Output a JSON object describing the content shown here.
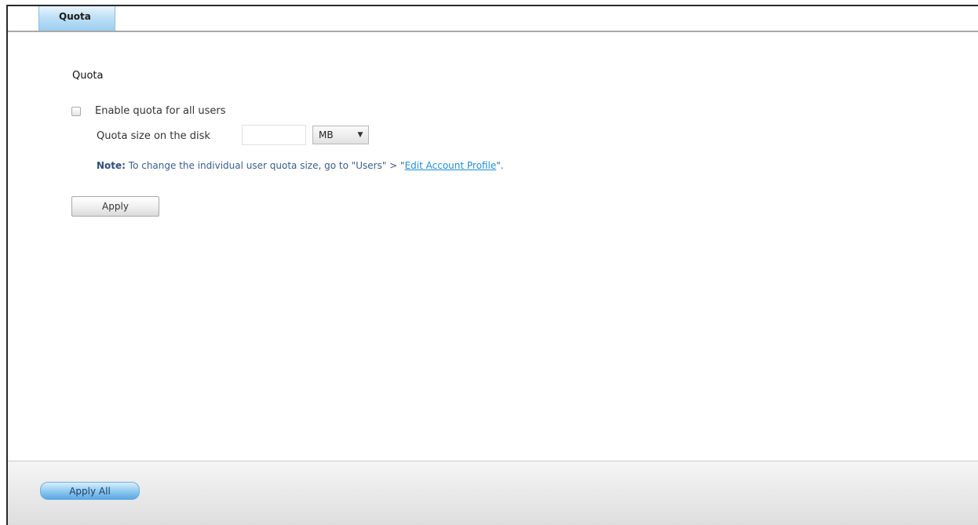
{
  "tabs": [
    {
      "label": "Quota",
      "active": true
    }
  ],
  "section": {
    "title": "Quota"
  },
  "quota": {
    "enable_label": "Enable quota for all users",
    "enable_checked": false,
    "size_label": "Quota size on the disk",
    "size_value": "",
    "unit_selected": "MB"
  },
  "note": {
    "prefix": "Note:",
    "text": " To change the individual user quota size, go to \"Users\" > \"",
    "link": "Edit Account Profile",
    "suffix": "\"."
  },
  "buttons": {
    "apply": "Apply",
    "apply_all": "Apply All"
  },
  "colors": {
    "tab_active": "#9ccff0",
    "link": "#1f8fd6",
    "note_text": "#3a5e8c",
    "apply_all_button": "#5aa8e2"
  },
  "icons": {
    "select_arrow": "chevron-down-icon"
  }
}
